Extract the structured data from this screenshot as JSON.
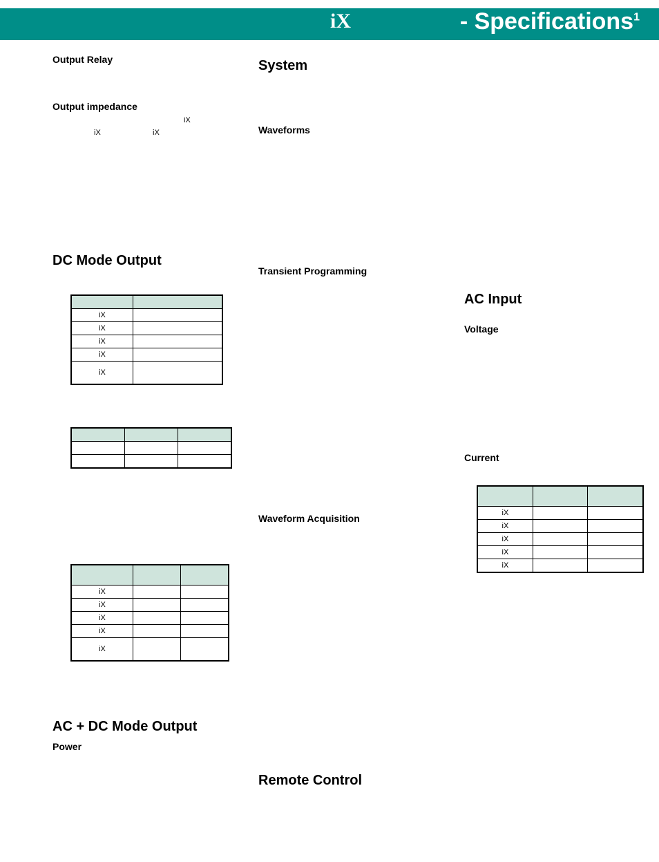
{
  "banner": {
    "ix": "iX",
    "title_prefix": "- Specifications",
    "title_sup": "1"
  },
  "col1": {
    "output_relay": "Output Relay",
    "output_impedance": "Output impedance",
    "oi_ix_a": "iX",
    "oi_ix_b": "iX",
    "oi_ix_c": "iX",
    "dc_mode": "DC Mode Output",
    "tbl1": {
      "h": [
        "",
        ""
      ],
      "rows": [
        [
          "iX",
          ""
        ],
        [
          "iX",
          ""
        ],
        [
          "iX",
          ""
        ],
        [
          "iX",
          ""
        ],
        [
          "iX",
          ""
        ]
      ]
    },
    "tbl2": {
      "h": [
        "",
        "",
        ""
      ],
      "rows": [
        [
          "",
          "",
          ""
        ],
        [
          "",
          "",
          ""
        ]
      ]
    },
    "tbl3": {
      "h": [
        "",
        "",
        ""
      ],
      "rows": [
        [
          "iX",
          "",
          ""
        ],
        [
          "iX",
          "",
          ""
        ],
        [
          "iX",
          "",
          ""
        ],
        [
          "iX",
          "",
          ""
        ],
        [
          "iX",
          "",
          ""
        ]
      ]
    },
    "acdc_mode": "AC + DC Mode Output",
    "power": "Power"
  },
  "col2": {
    "system": "System",
    "waveforms": "Waveforms",
    "transient": "Transient Programming",
    "wave_acq": "Waveform Acquisition",
    "remote": "Remote Control"
  },
  "col3": {
    "ac_input": "AC Input",
    "voltage": "Voltage",
    "current": "Current",
    "tbl": {
      "h": [
        "",
        "",
        ""
      ],
      "rows": [
        [
          "iX",
          "",
          ""
        ],
        [
          "iX",
          "",
          ""
        ],
        [
          "iX",
          "",
          ""
        ],
        [
          "iX",
          "",
          ""
        ],
        [
          "iX",
          "",
          ""
        ]
      ]
    }
  }
}
